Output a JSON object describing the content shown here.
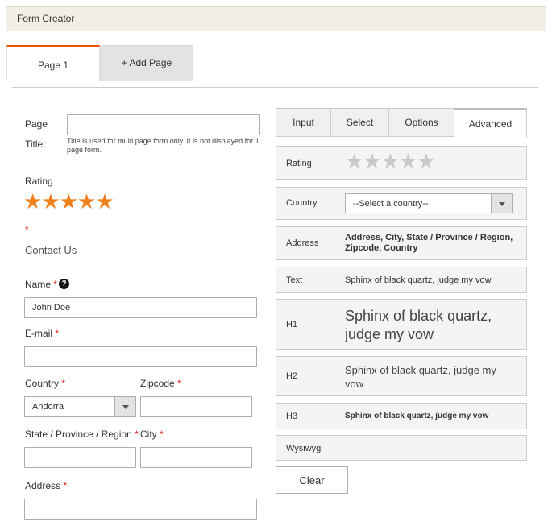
{
  "window": {
    "title": "Form Creator"
  },
  "page_tabs": {
    "active": "Page 1",
    "add": "+ Add Page"
  },
  "page_title": {
    "label_line1": "Page",
    "label_line2": "Title:",
    "value": "",
    "note": "Title is used for multi page form only. It is not displayed for 1 page form."
  },
  "rating": {
    "label": "Rating",
    "stars": "★★★★★",
    "required_mark": "*"
  },
  "contact_heading": "Contact Us",
  "fields": {
    "name": {
      "label": "Name",
      "req": "*",
      "value": "John Doe",
      "help": "?"
    },
    "email": {
      "label": "E-mail",
      "req": "*",
      "value": ""
    },
    "country": {
      "label": "Country",
      "req": "*",
      "value": "Andorra"
    },
    "zipcode": {
      "label": "Zipcode",
      "req": "*",
      "value": ""
    },
    "state": {
      "label": "State / Province / Region",
      "req": "*",
      "value": ""
    },
    "city": {
      "label": "City",
      "req": "*",
      "value": ""
    },
    "address": {
      "label": "Address",
      "req": "*",
      "value": ""
    }
  },
  "element_tabs": [
    "Input",
    "Select",
    "Options",
    "Advanced"
  ],
  "advanced": {
    "rating": {
      "label": "Rating",
      "stars": "★★★★★"
    },
    "country": {
      "label": "Country",
      "placeholder": "--Select a country--"
    },
    "address": {
      "label": "Address",
      "value": "Address, City, State / Province / Region, Zipcode, Country"
    },
    "text": {
      "label": "Text",
      "value": "Sphinx of black quartz, judge my vow"
    },
    "h1": {
      "label": "H1",
      "value": "Sphinx of black quartz, judge my vow"
    },
    "h2": {
      "label": "H2",
      "value": "Sphinx of black quartz, judge my vow"
    },
    "h3": {
      "label": "H3",
      "value": "Sphinx of black quartz, judge my vow"
    },
    "wysiwyg": {
      "label": "Wysiwyg"
    }
  },
  "clear_button": "Clear",
  "colors": {
    "accent": "#eb5202",
    "star_active": "#f07f1c",
    "star_inactive": "#c9c9c9",
    "required": "#e22626"
  }
}
